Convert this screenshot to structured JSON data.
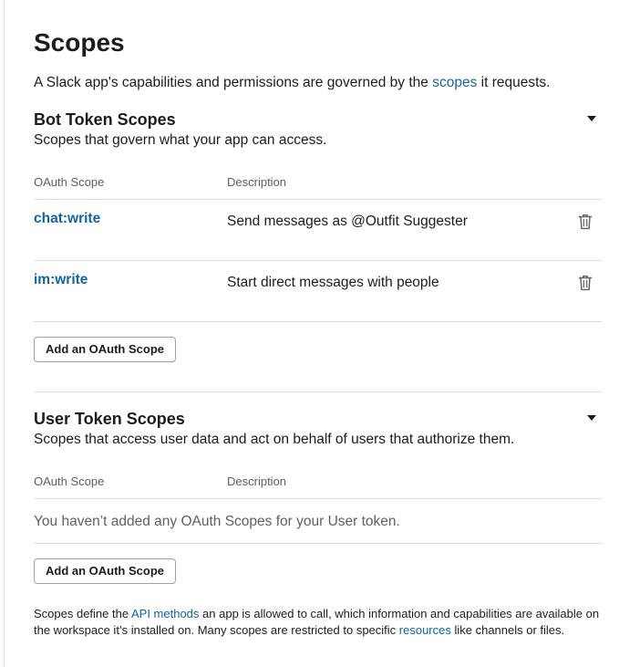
{
  "page": {
    "title": "Scopes",
    "intro_before": "A Slack app's capabilities and permissions are governed by the ",
    "intro_link": "scopes",
    "intro_after": " it requests."
  },
  "bot_section": {
    "title": "Bot Token Scopes",
    "description": "Scopes that govern what your app can access.",
    "col_scope": "OAuth Scope",
    "col_description": "Description",
    "rows": [
      {
        "scope": "chat:write",
        "description": "Send messages as @Outfit Suggester"
      },
      {
        "scope": "im:write",
        "description": "Start direct messages with people"
      }
    ],
    "add_button": "Add an OAuth Scope"
  },
  "user_section": {
    "title": "User Token Scopes",
    "description": "Scopes that access user data and act on behalf of users that authorize them.",
    "col_scope": "OAuth Scope",
    "col_description": "Description",
    "empty_message": "You haven’t added any OAuth Scopes for your User token.",
    "add_button": "Add an OAuth Scope"
  },
  "footer": {
    "part1": "Scopes define the ",
    "link1": "API methods",
    "part2": " an app is allowed to call, which information and capabilities are available on the workspace it’s installed on. Many scopes are restricted to specific ",
    "link2": "resources",
    "part3": " like channels or files."
  },
  "icons": {
    "collapse": "caret-down-icon",
    "remove": "trash-icon"
  },
  "colors": {
    "link": "#1264a3",
    "text": "#1d1c1d",
    "muted": "#616061",
    "divider": "#dddddd"
  }
}
